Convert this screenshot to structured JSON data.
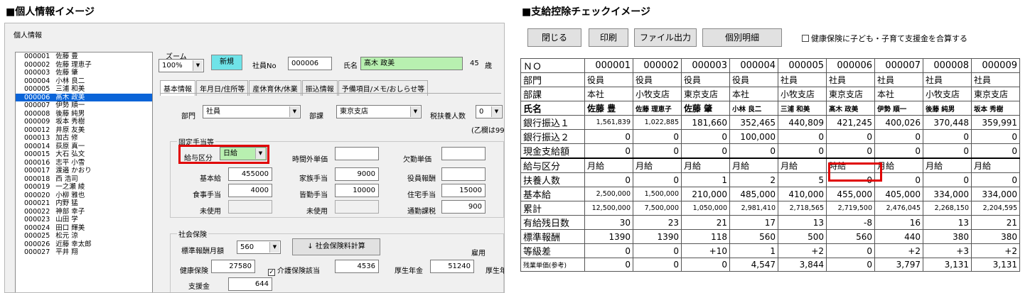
{
  "left_title": "■個人情報イメージ",
  "right_title": "■支給控除チェックイメージ",
  "window": {
    "title": "個人情報"
  },
  "employees": [
    {
      "code": "000001",
      "name": "佐藤 豊"
    },
    {
      "code": "000002",
      "name": "佐藤 理恵子"
    },
    {
      "code": "000003",
      "name": "佐藤 肇"
    },
    {
      "code": "000004",
      "name": "小林 良二"
    },
    {
      "code": "000005",
      "name": "三浦 和美"
    },
    {
      "code": "000006",
      "name": "髙木 政美"
    },
    {
      "code": "000007",
      "name": "伊勢 順一"
    },
    {
      "code": "000008",
      "name": "後藤 純男"
    },
    {
      "code": "000009",
      "name": "坂本 秀樹"
    },
    {
      "code": "000012",
      "name": "井原 友美"
    },
    {
      "code": "000013",
      "name": "加古 修"
    },
    {
      "code": "000014",
      "name": "荻原 真一"
    },
    {
      "code": "000015",
      "name": "大石 弘文"
    },
    {
      "code": "000016",
      "name": "志平 小雪"
    },
    {
      "code": "000017",
      "name": "渡邉 かおり"
    },
    {
      "code": "000018",
      "name": "西 浩司"
    },
    {
      "code": "000019",
      "name": "一之瀬 綾"
    },
    {
      "code": "000020",
      "name": "小柳 雅也"
    },
    {
      "code": "000021",
      "name": "内野 猛"
    },
    {
      "code": "000022",
      "name": "神部 幸子"
    },
    {
      "code": "000023",
      "name": "山田 学"
    },
    {
      "code": "000024",
      "name": "田口 輝美"
    },
    {
      "code": "000025",
      "name": "松元 涼"
    },
    {
      "code": "000026",
      "name": "近藤 幸太郎"
    },
    {
      "code": "000027",
      "name": "平井 翔"
    }
  ],
  "form": {
    "zoom_label": "ズーム",
    "zoom_value": "100%",
    "new_button": "新規",
    "emp_no_label": "社員No",
    "emp_no": "000006",
    "name_label": "氏名",
    "name": "髙木 政美",
    "age": "45",
    "age_unit": "歳",
    "tabs": [
      "基本情報",
      "年月日/住所等",
      "産休育休/休業",
      "振込情報",
      "予備項目/メモ/おしらせ等"
    ],
    "dept_label": "部門",
    "dept": "社員",
    "section_label": "部課",
    "section": "東京支店",
    "dependents_label": "税扶養人数",
    "dependents": "0",
    "otsu_note": "(乙欄は99)",
    "fixed_allow_title": "固定手当等",
    "pay_type_label": "給与区分",
    "pay_type": "日給",
    "overtime_label": "時間外単価",
    "overtime": "",
    "absence_label": "欠勤単価",
    "absence": "",
    "base_label": "基本給",
    "base": "455000",
    "family_label": "家族手当",
    "family": "9000",
    "officer_label": "役員報酬",
    "officer": "",
    "meal_label": "食事手当",
    "meal": "4000",
    "duty_label": "皆勤手当",
    "duty": "10000",
    "housing_label": "住宅手当",
    "housing": "15000",
    "unused1_label": "未使用",
    "unused2_label": "未使用",
    "commute_label": "通勤課税",
    "commute": "900",
    "social_title": "社会保険",
    "std_label": "標準報酬月額",
    "std": "560",
    "calc_button": "↓ 社会保険料計算",
    "health_label": "健康保険",
    "health": "27580",
    "care_label": "介護保険該当",
    "care_checked": "✓",
    "care": "4536",
    "pension_label": "厚生年金",
    "pension": "51240",
    "pension2_label": "厚生年",
    "employ_label": "雇用",
    "support_label": "支援金",
    "support": "644"
  },
  "right": {
    "buttons": {
      "close": "閉じる",
      "print": "印刷",
      "export": "ファイル出力",
      "detail": "個別明細"
    },
    "checkbox_label": "健康保険に子ども・子育て支援金を合算する",
    "rows": [
      {
        "label": "ＮＯ",
        "cells": [
          "000001",
          "000002",
          "000003",
          "000004",
          "000005",
          "000006",
          "000007",
          "000008",
          "000009"
        ],
        "type": "num",
        "big": true
      },
      {
        "label": "部門",
        "cells": [
          "役員",
          "役員",
          "役員",
          "役員",
          "社員",
          "社員",
          "社員",
          "社員",
          "社員"
        ],
        "type": "text"
      },
      {
        "label": "部課",
        "cells": [
          "本社",
          "小牧支店",
          "東京支店",
          "本社",
          "小牧支店",
          "東京支店",
          "本社",
          "小牧支店",
          "東京支店"
        ],
        "type": "text"
      },
      {
        "label": "氏名",
        "cells": [
          "佐藤 豊",
          "佐藤 理恵子",
          "佐藤 肇",
          "小林 良二",
          "三浦 和美",
          "髙木 政美",
          "伊勢 順一",
          "後藤 純男",
          "坂本 秀樹"
        ],
        "type": "text",
        "bold": true
      },
      {
        "label": "銀行振込１",
        "cells": [
          "1,561,839",
          "1,022,885",
          "181,660",
          "352,465",
          "440,809",
          "421,245",
          "400,026",
          "370,448",
          "359,991"
        ],
        "type": "num"
      },
      {
        "label": "銀行振込２",
        "cells": [
          "0",
          "0",
          "0",
          "100,000",
          "0",
          "0",
          "0",
          "0",
          "0"
        ],
        "type": "num"
      },
      {
        "label": "現金支給額",
        "cells": [
          "0",
          "0",
          "0",
          "0",
          "0",
          "0",
          "0",
          "0",
          "0"
        ],
        "type": "num"
      },
      {
        "label": "給与区分",
        "cells": [
          "月給",
          "月給",
          "月給",
          "月給",
          "月給",
          "時給",
          "月給",
          "月給",
          "月給"
        ],
        "type": "text",
        "thick": true
      },
      {
        "label": "扶養人数",
        "cells": [
          "0",
          "0",
          "1",
          "2",
          "5",
          "0",
          "0",
          "0",
          "0"
        ],
        "type": "num"
      },
      {
        "label": "基本給",
        "cells": [
          "2,500,000",
          "1,500,000",
          "210,000",
          "485,000",
          "410,000",
          "455,000",
          "405,000",
          "334,000",
          "334,000"
        ],
        "type": "num"
      },
      {
        "label": "累計",
        "cells": [
          "12,500,000",
          "7,500,000",
          "1,050,000",
          "2,981,410",
          "2,718,565",
          "2,719,500",
          "2,476,045",
          "2,268,150",
          "2,204,595"
        ],
        "type": "num"
      },
      {
        "label": "有給残日数",
        "cells": [
          "30",
          "23",
          "21",
          "17",
          "13",
          "-8",
          "16",
          "13",
          "21"
        ],
        "type": "num"
      },
      {
        "label": "標準報酬",
        "cells": [
          "1390",
          "1390",
          "118",
          "560",
          "500",
          "560",
          "440",
          "380",
          "380"
        ],
        "type": "num"
      },
      {
        "label": "等級差",
        "cells": [
          "0",
          "0",
          "+10",
          "1",
          "+2",
          "0",
          "+2",
          "+3",
          "+2"
        ],
        "type": "num"
      },
      {
        "label": "残業単価(参考)",
        "cells": [
          "0",
          "0",
          "0",
          "4,547",
          "3,844",
          "0",
          "3,797",
          "3,131",
          "3,131"
        ],
        "type": "num",
        "smalllabel": true
      }
    ]
  }
}
